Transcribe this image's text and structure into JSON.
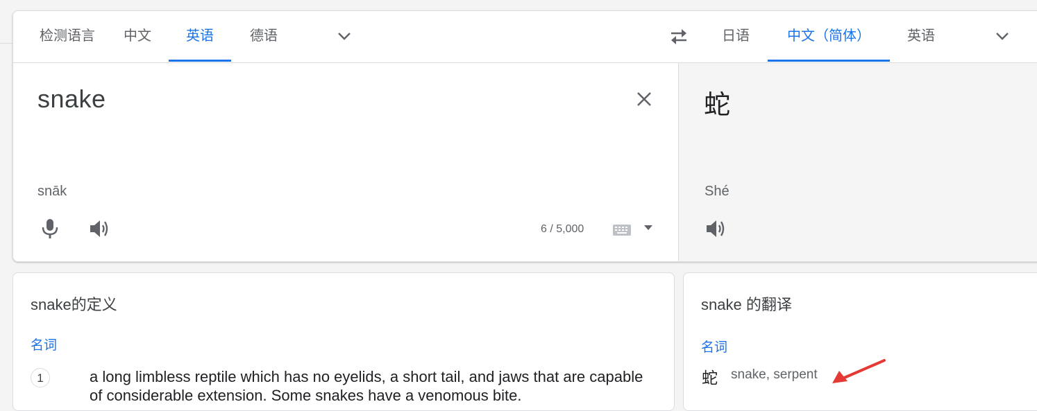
{
  "source_languages": {
    "detect": "检测语言",
    "tabs": [
      "中文",
      "英语",
      "德语"
    ],
    "active_index": 1
  },
  "target_languages": {
    "tabs": [
      "日语",
      "中文（简体）",
      "英语"
    ],
    "active_index": 1
  },
  "source": {
    "text": "snake",
    "transliteration": "snāk",
    "char_count": "6 / 5,000"
  },
  "target": {
    "text": "蛇",
    "transliteration": "Shé"
  },
  "definitions": {
    "title": "snake的定义",
    "part_of_speech": "名词",
    "items": [
      {
        "number": "1",
        "text": "a long limbless reptile which has no eyelids, a short tail, and jaws that are capable of considerable extension. Some snakes have a venomous bite."
      }
    ]
  },
  "translations": {
    "title": "snake 的翻译",
    "part_of_speech": "名词",
    "word": "蛇",
    "synonyms": "snake, serpent"
  },
  "colors": {
    "accent": "#1a73e8",
    "annotation_arrow": "#e53935"
  },
  "icons": [
    "chevron-down-icon",
    "swap-icon",
    "close-icon",
    "microphone-icon",
    "speaker-icon",
    "keyboard-icon",
    "arrow-annotation"
  ]
}
